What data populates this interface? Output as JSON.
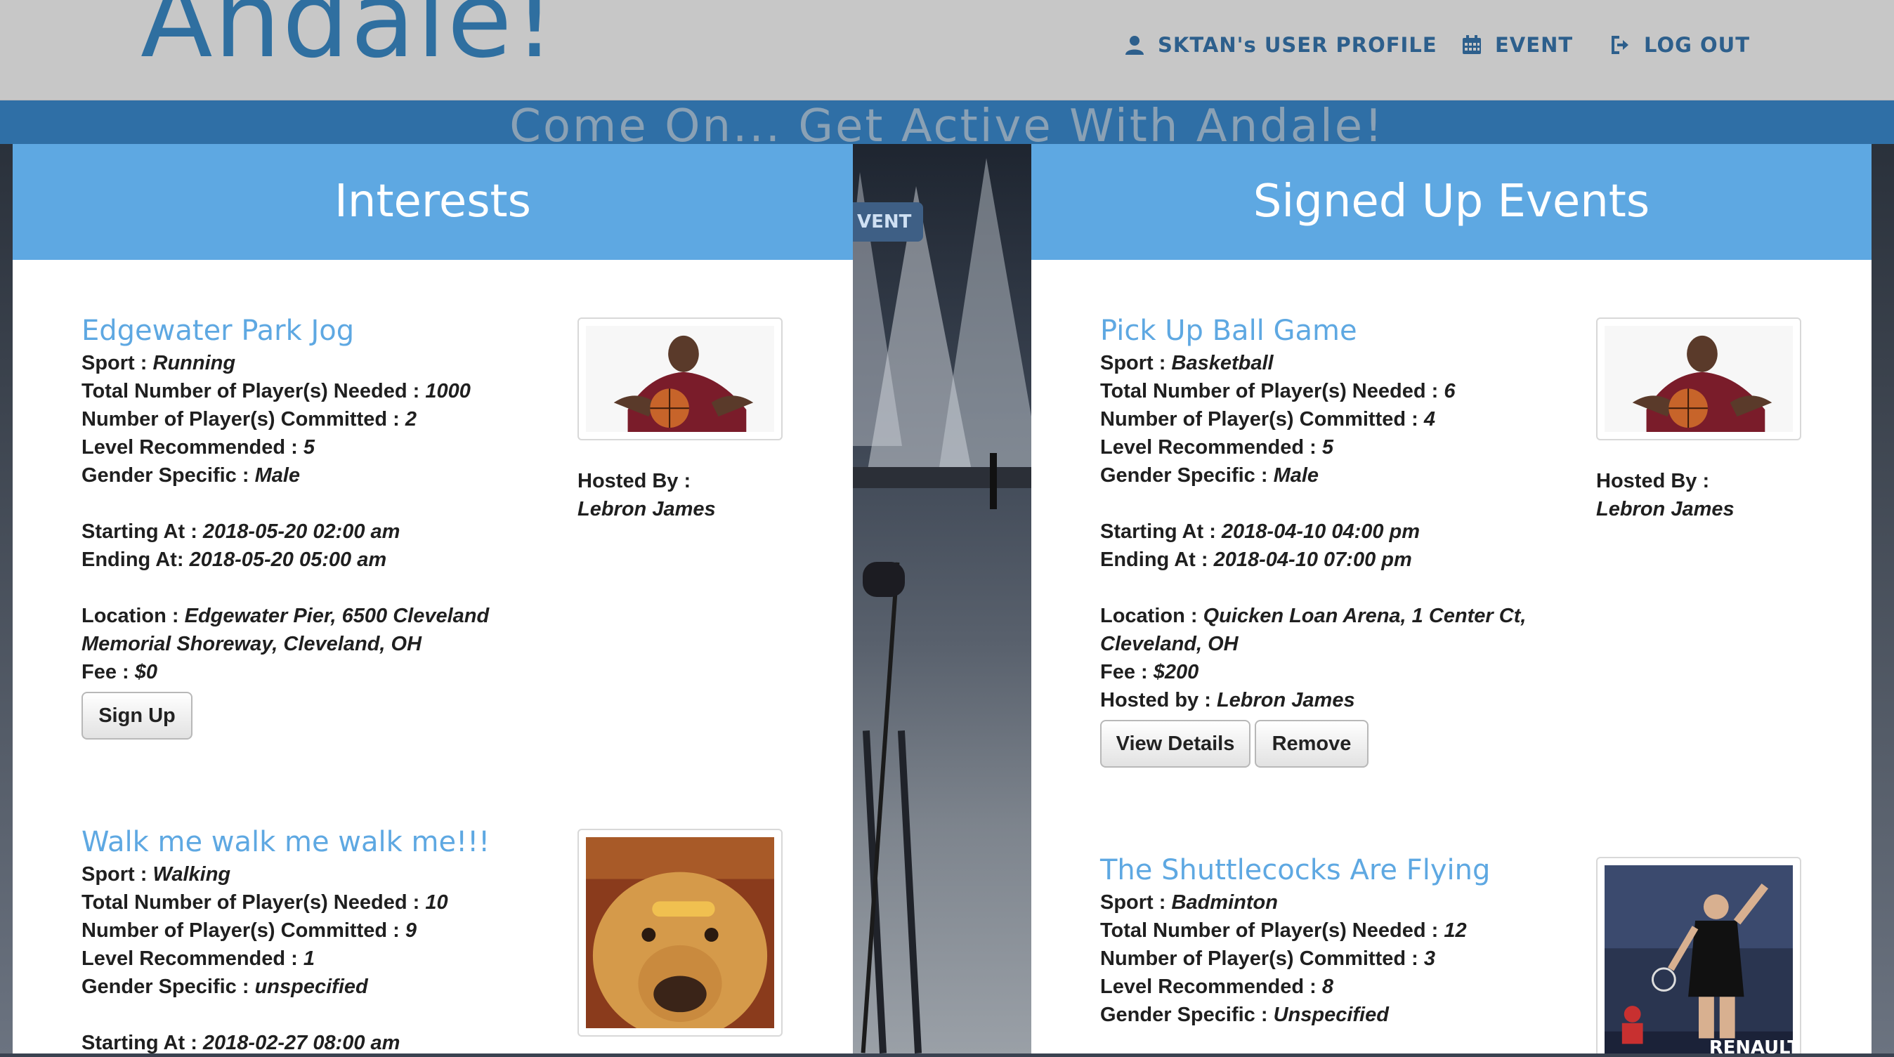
{
  "navbar": {
    "brand": "Andale!",
    "profile_label": "SKTAN's USER PROFILE",
    "event_label": "EVENT",
    "logout_label": "LOG OUT"
  },
  "banner": {
    "text": "Come On... Get Active With Andale!",
    "background_nav_fragment": "VENT"
  },
  "interests": {
    "heading": "Interests",
    "events": [
      {
        "title": "Edgewater Park Jog",
        "sport_label": "Sport :",
        "sport": "Running",
        "needed_label": "Total Number of Player(s) Needed :",
        "needed": "1000",
        "committed_label": "Number of Player(s) Committed :",
        "committed": "2",
        "level_label": "Level Recommended :",
        "level": "5",
        "gender_label": "Gender Specific :",
        "gender": "Male",
        "start_label": "Starting At :",
        "start": "2018-05-20 02:00 am",
        "end_label": "Ending At:",
        "end": "2018-05-20 05:00 am",
        "location_label": "Location :",
        "location_line1": "Edgewater Pier, 6500 Cleveland",
        "location_line2": "Memorial Shoreway, Cleveland, OH",
        "fee_label": "Fee :",
        "fee": "$0",
        "hosted_label": "Hosted By :",
        "host": "Lebron James",
        "button": "Sign Up",
        "image_icon": "basketball-player-photo"
      },
      {
        "title": "Walk me walk me walk me!!!",
        "sport_label": "Sport :",
        "sport": "Walking",
        "needed_label": "Total Number of Player(s) Needed :",
        "needed": "10",
        "committed_label": "Number of Player(s) Committed :",
        "committed": "9",
        "level_label": "Level Recommended :",
        "level": "1",
        "gender_label": "Gender Specific :",
        "gender": "unspecified",
        "start_label": "Starting At :",
        "start": "2018-02-27 08:00 am",
        "image_icon": "golden-retriever-photo"
      }
    ]
  },
  "signed_up": {
    "heading": "Signed Up Events",
    "events": [
      {
        "title": "Pick Up Ball Game",
        "sport_label": "Sport :",
        "sport": "Basketball",
        "needed_label": "Total Number of Player(s) Needed :",
        "needed": "6",
        "committed_label": "Number of Player(s) Committed :",
        "committed": "4",
        "level_label": "Level Recommended :",
        "level": "5",
        "gender_label": "Gender Specific :",
        "gender": "Male",
        "start_label": "Starting At :",
        "start": "2018-04-10 04:00 pm",
        "end_label": "Ending At :",
        "end": "2018-04-10 07:00 pm",
        "location_label": "Location :",
        "location_line1": "Quicken Loan Arena, 1 Center Ct,",
        "location_line2": "Cleveland, OH",
        "fee_label": "Fee :",
        "fee": "$200",
        "hostedby_label": "Hosted by :",
        "hostedby": "Lebron James",
        "hosted_label": "Hosted By :",
        "host": "Lebron James",
        "view_button": "View Details",
        "remove_button": "Remove",
        "image_icon": "basketball-player-photo"
      },
      {
        "title": "The Shuttlecocks Are Flying",
        "sport_label": "Sport :",
        "sport": "Badminton",
        "needed_label": "Total Number of Player(s) Needed :",
        "needed": "12",
        "committed_label": "Number of Player(s) Committed :",
        "committed": "3",
        "level_label": "Level Recommended :",
        "level": "8",
        "gender_label": "Gender Specific :",
        "gender": "Unspecified",
        "sponsor_text": "RENAULT",
        "image_icon": "badminton-player-photo"
      }
    ]
  },
  "colors": {
    "panel_header": "#5ea8e2",
    "title_blue": "#5ea8e2",
    "nav_text": "#2d5f8c",
    "banner": "#2f6fa6"
  }
}
